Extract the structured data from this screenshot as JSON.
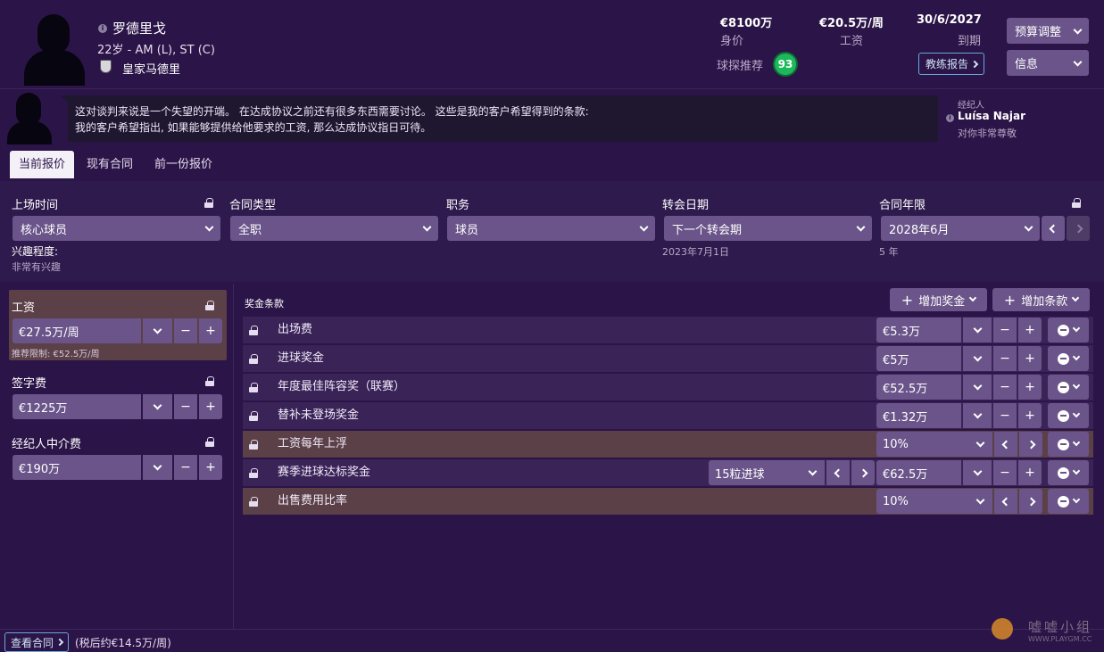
{
  "player": {
    "name": "罗德里戈",
    "age_positions": "22岁 - AM (L), ST (C)",
    "club": "皇家马德里"
  },
  "stats": [
    {
      "value": "€8100万",
      "label": "身价"
    },
    {
      "value": "€20.5万/周",
      "label": "工资"
    },
    {
      "value": "30/6/2027",
      "label": "到期"
    }
  ],
  "scout": {
    "label": "球探推荐",
    "score": "93"
  },
  "coach_report_label": "教练报告",
  "header_buttons": {
    "budget": "预算调整",
    "info": "信息"
  },
  "message": {
    "line1": "这对谈判来说是一个失望的开端。 在达成协议之前还有很多东西需要讨论。 这些是我的客户希望得到的条款:",
    "line2": "我的客户希望指出, 如果能够提供给他要求的工资, 那么达成协议指日可待。"
  },
  "agent": {
    "role": "经纪人",
    "name": "Luísa Najar",
    "attitude": "对你非常尊敬"
  },
  "tabs": [
    "当前报价",
    "现有合同",
    "前一份报价"
  ],
  "terms": {
    "playing_time": {
      "label": "上场时间",
      "value": "核心球员"
    },
    "contract_type": {
      "label": "合同类型",
      "value": "全职"
    },
    "role": {
      "label": "职务",
      "value": "球员"
    },
    "transfer_date": {
      "label": "转会日期",
      "value": "下一个转会期",
      "sub": "2023年7月1日"
    },
    "contract_length": {
      "label": "合同年限",
      "value": "2028年6月",
      "sub": "5 年"
    },
    "interest": {
      "label": "兴趣程度:",
      "value": "非常有兴趣"
    }
  },
  "wage": {
    "label": "工资",
    "value": "€27.5万/周",
    "recommend": "推荐限制: €52.5万/周"
  },
  "signing_fee": {
    "label": "签字费",
    "value": "€1225万"
  },
  "agent_fee": {
    "label": "经纪人中介费",
    "value": "€190万"
  },
  "bonus": {
    "title": "奖金条款",
    "add_bonus": "增加奖金",
    "add_clause": "增加条款",
    "rows": [
      {
        "label": "出场费",
        "value": "€5.3万"
      },
      {
        "label": "进球奖金",
        "value": "€5万"
      },
      {
        "label": "年度最佳阵容奖（联赛）",
        "value": "€52.5万"
      },
      {
        "label": "替补未登场奖金",
        "value": "€1.32万"
      },
      {
        "label": "工资每年上浮",
        "value": "10%"
      },
      {
        "label": "赛季进球达标奖金",
        "value": "€62.5万",
        "condition": "15粒进球"
      },
      {
        "label": "出售费用比率",
        "value": "10%"
      }
    ]
  },
  "footer": {
    "view_contract": "查看合同",
    "after_tax": "(税后约€14.5万/周)"
  },
  "watermark": {
    "text": "嘘嘘小组",
    "url": "WWW.PLAYGM.CC"
  },
  "colors": {
    "bg": "#2b1447",
    "control": "#6a5489",
    "highlight_row": "#5b4047",
    "scout_badge": "#1db85b"
  }
}
